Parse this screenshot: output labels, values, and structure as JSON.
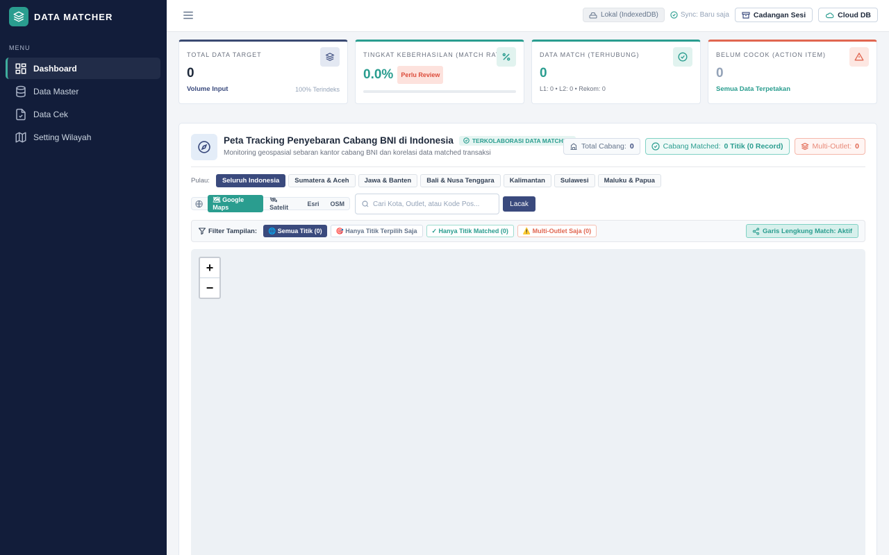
{
  "brand": {
    "name": "DATA MATCHER"
  },
  "sidebar": {
    "menu_label": "MENU",
    "items": [
      {
        "label": "Dashboard",
        "icon": "dashboard-icon",
        "active": true
      },
      {
        "label": "Data Master",
        "icon": "database-icon"
      },
      {
        "label": "Data Cek",
        "icon": "file-check-icon"
      },
      {
        "label": "Setting Wilayah",
        "icon": "map-icon"
      }
    ]
  },
  "topbar": {
    "storage_label": "Lokal (IndexedDB)",
    "sync_label": "Sync: Baru saja",
    "backup_label": "Cadangan Sesi",
    "cloud_label": "Cloud DB"
  },
  "kpis": [
    {
      "title": "TOTAL DATA TARGET",
      "value": "0",
      "sub_left": "Volume Input",
      "sub_right": "100% Terindeks"
    },
    {
      "title": "TINGKAT KEBERHASILAN (MATCH RATE)",
      "value": "0.0%",
      "badge": "Perlu Review",
      "progress": 0
    },
    {
      "title": "DATA MATCH (TERHUBUNG)",
      "value": "0",
      "sub": "L1: 0 • L2: 0 • Rekom: 0"
    },
    {
      "title": "BELUM COCOK (ACTION ITEM)",
      "value": "0",
      "sub": "Semua Data Terpetakan"
    }
  ],
  "panel": {
    "title": "Peta Tracking Penyebaran Cabang BNI di Indonesia",
    "tag": "TERKOLABORASI DATA MATCHED",
    "subtitle": "Monitoring geospasial sebaran kantor cabang BNI dan korelasi data matched transaksi",
    "stats": {
      "total_label": "Total Cabang:",
      "total_value": "0",
      "matched_label": "Cabang Matched:",
      "matched_value": "0 Titik (0 Record)",
      "multi_label": "Multi-Outlet:",
      "multi_value": "0"
    },
    "islands_label": "Pulau:",
    "islands": [
      "Seluruh Indonesia",
      "Sumatera & Aceh",
      "Jawa & Banten",
      "Bali & Nusa Tenggara",
      "Kalimantan",
      "Sulawesi",
      "Maluku & Papua"
    ],
    "map_types": [
      "🗺 Google Maps",
      "🛰 Satelit",
      "Esri",
      "OSM"
    ],
    "search_placeholder": "Cari Kota, Outlet, atau Kode Pos...",
    "search_button": "Lacak",
    "filter_label": "Filter Tampilan:",
    "filters": [
      "🌐 Semua Titik (0)",
      "🎯 Hanya Titik Terpilih Saja",
      "✓ Hanya Titik Matched (0)",
      "⚠️ Multi-Outlet Saja (0)"
    ],
    "arcs_toggle": "Garis Lengkung Match: Aktif",
    "zoom_in": "+",
    "zoom_out": "−"
  },
  "colors": {
    "sidebar_bg": "#121d3a",
    "accent_teal": "#2a9d8f",
    "primary_navy": "#3a4a7d",
    "warning_red": "#e06650"
  }
}
